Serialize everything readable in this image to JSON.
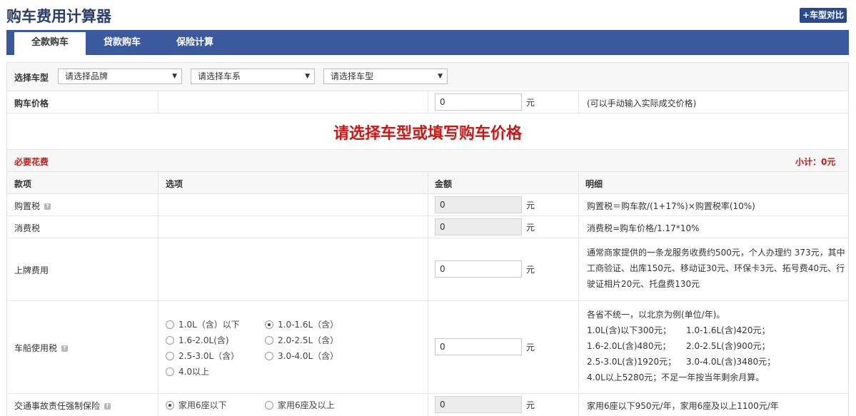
{
  "page": {
    "title": "购车费用计算器",
    "compare_label": "+车型对比"
  },
  "tabs": [
    {
      "label": "全款购车",
      "active": true
    },
    {
      "label": "贷款购车",
      "active": false
    },
    {
      "label": "保险计算",
      "active": false
    }
  ],
  "select_car": {
    "label": "选择车型",
    "brand": "请选择品牌",
    "series": "请选择车系",
    "model": "请选择车型"
  },
  "price": {
    "label": "购车价格",
    "value": "0",
    "unit": "元",
    "hint": "(可以手动输入实际成交价格)"
  },
  "banner": "请选择车型或填写购车价格",
  "required": {
    "label": "必要花费",
    "subtotal": "小计：0元"
  },
  "columns": {
    "item": "款项",
    "option": "选项",
    "amount": "金额",
    "detail": "明细"
  },
  "purchase_tax": {
    "label": "购置税",
    "value": "0",
    "unit": "元",
    "detail": "购置税＝购车款/(1+17%)×购置税率(10%)"
  },
  "consumption_tax": {
    "label": "消费税",
    "value": "0",
    "unit": "元",
    "detail": "消费税=购车价格/1.17*10%"
  },
  "plate_fee": {
    "label": "上牌费用",
    "value": "0",
    "unit": "元",
    "detail": [
      "通常商家提供的一条龙服务收费约500元，个人办理约 373元，其中",
      "工商验证、出库150元、移动证30元、环保卡3元、拓号费40元、行",
      "驶证相片20元、托盘费130元"
    ]
  },
  "vessel_tax": {
    "label": "车船使用税",
    "value": "0",
    "unit": "元",
    "options": [
      {
        "label": "1.0L（含）以下",
        "checked": false
      },
      {
        "label": "1.0-1.6L（含）",
        "checked": true
      },
      {
        "label": "1.6-2.0L(含)",
        "checked": false
      },
      {
        "label": "2.0-2.5L（含）",
        "checked": false
      },
      {
        "label": "2.5-3.0L（含）",
        "checked": false
      },
      {
        "label": "3.0-4.0L（含）",
        "checked": false
      },
      {
        "label": "4.0以上",
        "checked": false
      }
    ],
    "detail": [
      "各省不统一，以北京为例(单位/年)。",
      "1.0L(含)以下300元；",
      "1.0-1.6L(含)420元；",
      "1.6-2.0L(含)480元；",
      "2.0-2.5L(含)900元；",
      "2.5-3.0L(含)1920元；",
      "3.0-4.0L(含)3480元；",
      "4.0L以上5280元；不足一年按当年剩余月算。"
    ]
  },
  "insurance": {
    "label": "交通事故责任强制保险",
    "value": "0",
    "unit": "元",
    "options": [
      {
        "label": "家用6座以下",
        "checked": true
      },
      {
        "label": "家用6座及以上",
        "checked": false
      }
    ],
    "detail": "家用6座以下950元/年，家用6座及以上1100元/年"
  },
  "colors": {
    "brand": "#3a5a9d",
    "accent_red": "#c81919"
  },
  "icons": {
    "help": "help-icon",
    "dropdown": "triangle-down-icon"
  }
}
